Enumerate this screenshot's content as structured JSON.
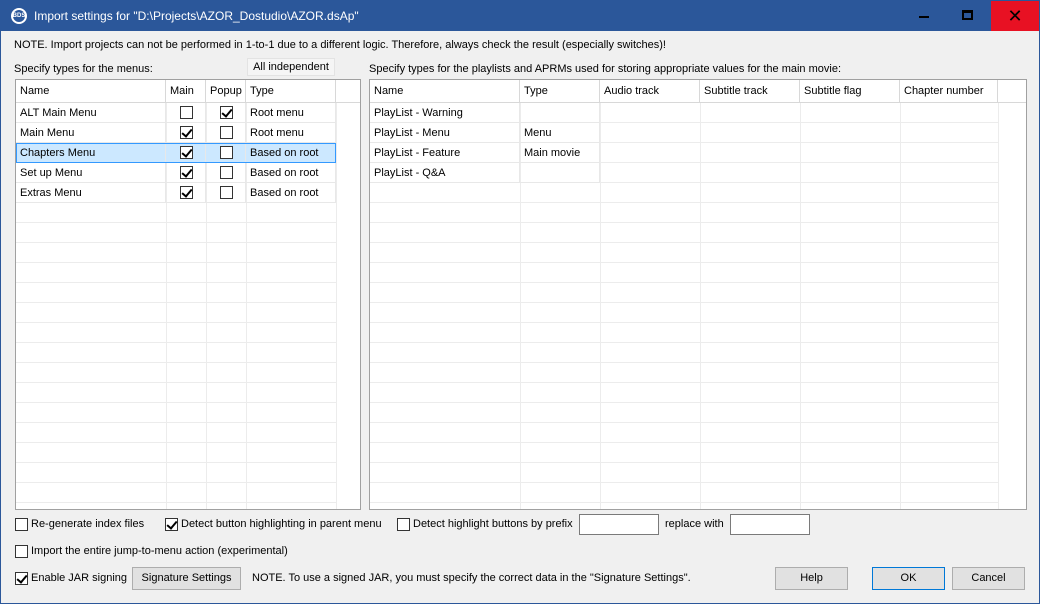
{
  "window": {
    "title": "Import settings for \"D:\\Projects\\AZOR_Dostudio\\AZOR.dsAp\"",
    "app_icon": "BDS",
    "minimize": "minimize-icon",
    "maximize": "maximize-icon",
    "close": "✕"
  },
  "note": "NOTE. Import projects can not be performed in 1-to-1 due to a different logic. Therefore, always check the result (especially switches)!",
  "menus": {
    "label": "Specify types for the menus:",
    "all_independent": "All independent",
    "columns": [
      "Name",
      "Main",
      "Popup",
      "Type"
    ],
    "rows": [
      {
        "name": "ALT Main Menu",
        "main": false,
        "popup": true,
        "type": "Root menu"
      },
      {
        "name": "Main Menu",
        "main": true,
        "popup": false,
        "type": "Root menu"
      },
      {
        "name": "Chapters Menu",
        "main": true,
        "popup": false,
        "type": "Based on root",
        "selected": true
      },
      {
        "name": "Set up Menu",
        "main": true,
        "popup": false,
        "type": "Based on root"
      },
      {
        "name": "Extras Menu",
        "main": true,
        "popup": false,
        "type": "Based on root"
      }
    ]
  },
  "playlists": {
    "label": "Specify types for the playlists and APRMs used for storing appropriate values for the main movie:",
    "columns": [
      "Name",
      "Type",
      "Audio track",
      "Subtitle track",
      "Subtitle flag",
      "Chapter number"
    ],
    "rows": [
      {
        "name": "PlayList - Warning",
        "type": ""
      },
      {
        "name": "PlayList - Menu",
        "type": "Menu"
      },
      {
        "name": "PlayList - Feature",
        "type": "Main movie"
      },
      {
        "name": "PlayList - Q&A",
        "type": ""
      }
    ]
  },
  "options": {
    "regen_index": {
      "label": "Re-generate index files",
      "checked": false
    },
    "detect_highlight_parent": {
      "label": "Detect button highlighting in parent menu",
      "checked": true
    },
    "detect_by_prefix": {
      "label": "Detect highlight buttons by prefix",
      "checked": false,
      "value": ""
    },
    "replace_with": {
      "label": "replace with",
      "value": ""
    },
    "import_jump": {
      "label": "Import the entire jump-to-menu action (experimental)",
      "checked": false
    },
    "jar_signing": {
      "label": "Enable JAR signing",
      "checked": true
    }
  },
  "signature_button": "Signature Settings",
  "jar_note": "NOTE. To use a signed JAR, you must specify the correct data in the \"Signature Settings\".",
  "buttons": {
    "help": "Help",
    "ok": "OK",
    "cancel": "Cancel"
  }
}
